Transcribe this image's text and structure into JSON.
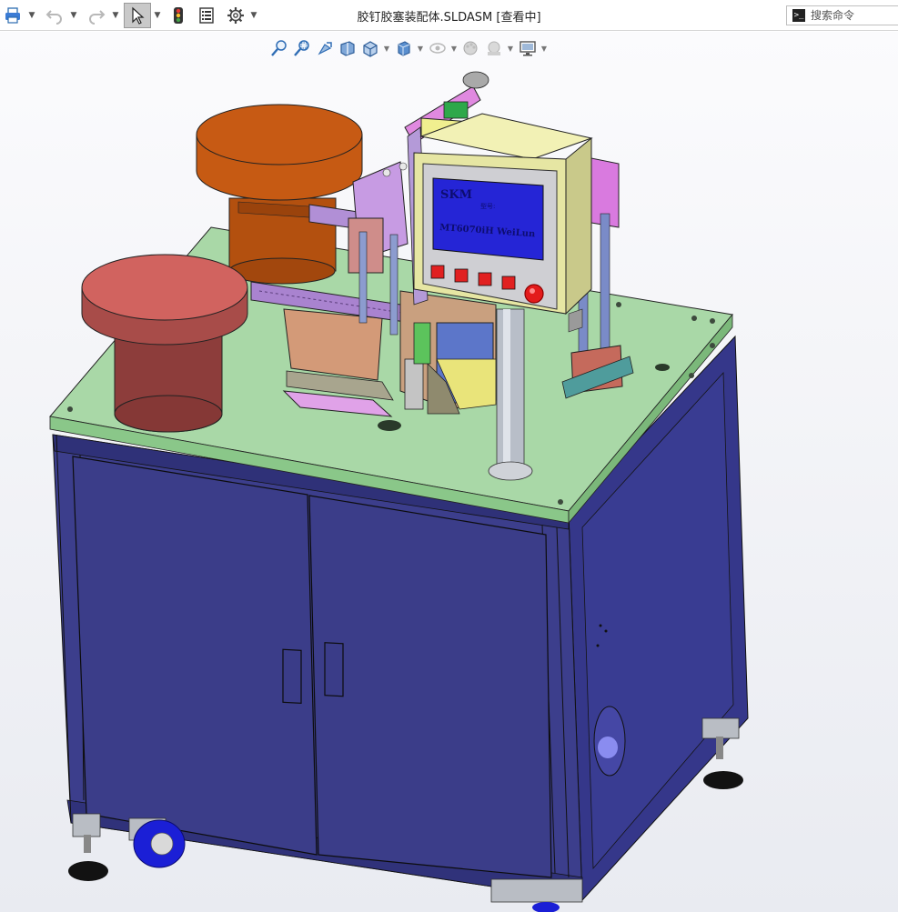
{
  "window": {
    "title": "胶钉胶塞装配体.SLDASM [查看中]"
  },
  "toolbar": {
    "items": [
      {
        "name": "print-icon"
      },
      {
        "name": "undo-icon"
      },
      {
        "name": "redo-icon"
      },
      {
        "name": "select-arrow-icon"
      },
      {
        "name": "rebuild-traffic-light-icon"
      },
      {
        "name": "file-properties-icon"
      },
      {
        "name": "options-gear-icon"
      }
    ]
  },
  "search": {
    "placeholder": "搜索命令"
  },
  "heads_up_toolbar": {
    "items": [
      "zoom-to-fit-icon",
      "zoom-to-area-icon",
      "previous-view-icon",
      "section-view-icon",
      "view-orientation-icon",
      "display-style-icon",
      "hide-show-items-icon",
      "edit-appearance-icon",
      "apply-scene-icon",
      "view-settings-icon"
    ]
  },
  "model": {
    "hmi_screen_lines": [
      "SKM",
      "MT6070iH WeiLun"
    ],
    "hmi_screen_sub": "型号:",
    "colors": {
      "table_top": "#a9d8a7",
      "cabinet": "#3d3f8c",
      "bowl_orange": "#c65a13",
      "bowl_red": "#d1635f",
      "screen_blue": "#2525d6",
      "panel_yellow": "#ececa6"
    }
  }
}
